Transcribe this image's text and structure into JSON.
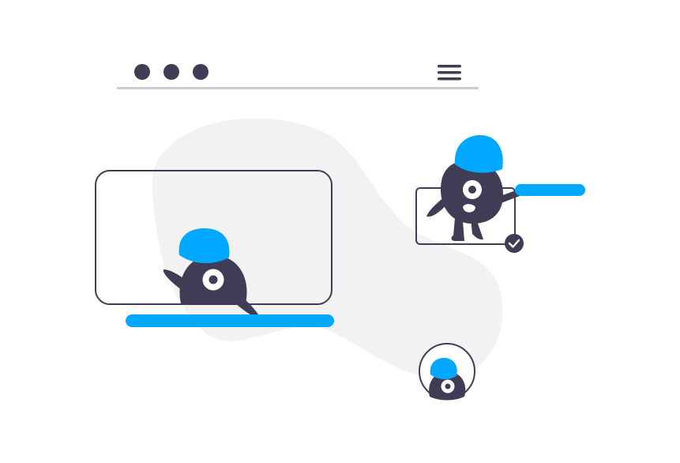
{
  "colors": {
    "dark": "#3f3d56",
    "accent": "#00a8ff",
    "blob": "#f2f2f2",
    "divider": "#cccccc",
    "white": "#ffffff"
  },
  "window": {
    "controls": [
      "window-dot",
      "window-dot",
      "window-dot"
    ],
    "menu_icon": "hamburger-menu-icon"
  },
  "cards": [
    {
      "kind": "video-frame",
      "character": "one-eyed-monster-waving"
    },
    {
      "kind": "selected-card",
      "character": "one-eyed-monster-standing",
      "badge_icon": "check-icon"
    },
    {
      "kind": "avatar-circle",
      "character": "one-eyed-monster-peeking"
    }
  ]
}
